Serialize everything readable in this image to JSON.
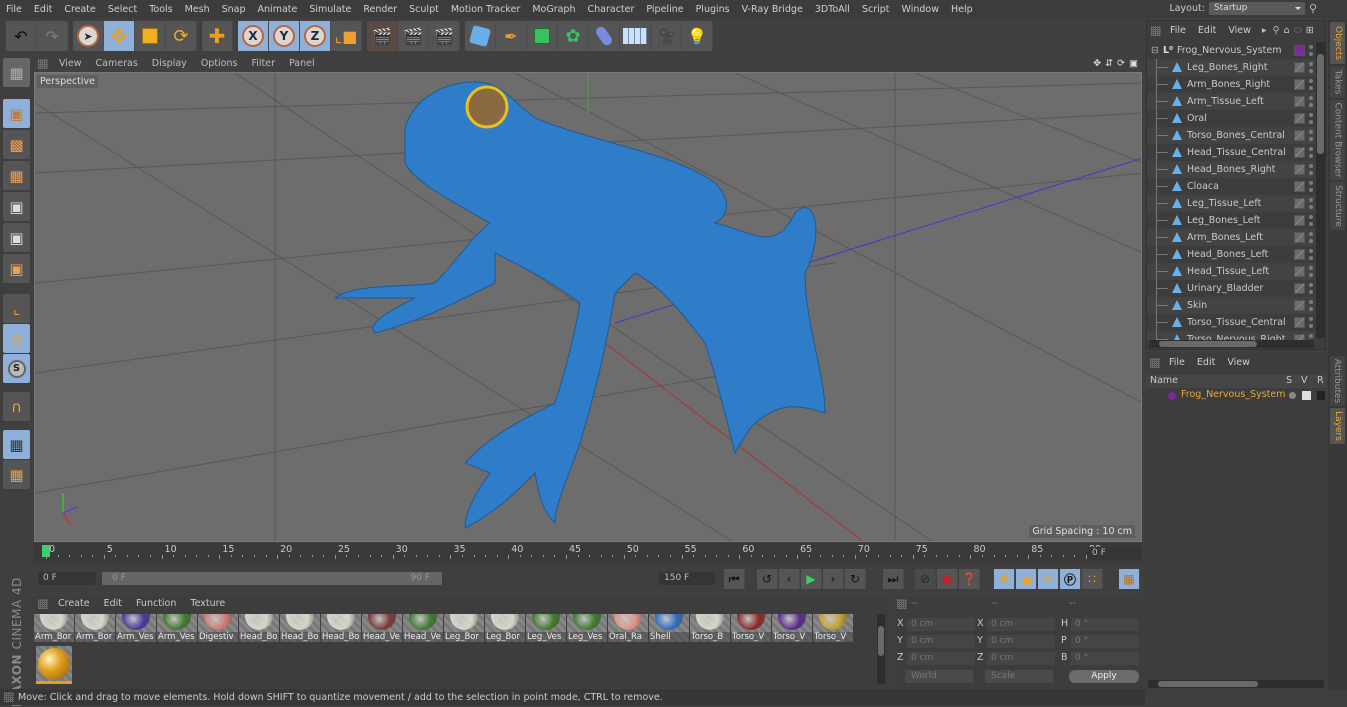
{
  "menubar": {
    "items": [
      "File",
      "Edit",
      "Create",
      "Select",
      "Tools",
      "Mesh",
      "Snap",
      "Animate",
      "Simulate",
      "Render",
      "Sculpt",
      "Motion Tracker",
      "MoGraph",
      "Character",
      "Pipeline",
      "Plugins",
      "V-Ray Bridge",
      "3DToAll",
      "Script",
      "Window",
      "Help"
    ],
    "layout_label": "Layout:",
    "layout_value": "Startup"
  },
  "toolbar": {
    "axis_x": "X",
    "axis_y": "Y",
    "axis_z": "Z"
  },
  "viewport": {
    "menu": [
      "View",
      "Cameras",
      "Display",
      "Options",
      "Filter",
      "Panel"
    ],
    "camera_label": "Perspective",
    "grid_spacing": "Grid Spacing : 10 cm",
    "colors": {
      "model": "#2f7dc8",
      "background": "#6d6d6d"
    }
  },
  "timeline": {
    "ticks": [
      "0",
      "5",
      "10",
      "15",
      "20",
      "25",
      "30",
      "35",
      "40",
      "45",
      "50",
      "55",
      "60",
      "65",
      "70",
      "75",
      "80",
      "85",
      "90"
    ],
    "current_frame": "0 F",
    "start_field": "0 F",
    "range_start": "0 F",
    "range_end": "90 F",
    "end_field": "150 F"
  },
  "materials": {
    "menu": [
      "Create",
      "Edit",
      "Function",
      "Texture"
    ],
    "items": [
      {
        "label": "Arm_Bor",
        "color": "#d8d4c8"
      },
      {
        "label": "Arm_Bor",
        "color": "#d8d4c8"
      },
      {
        "label": "Arm_Ves",
        "color": "#4a3a9a"
      },
      {
        "label": "Arm_Ves",
        "color": "#3f7a30"
      },
      {
        "label": "Digestiv",
        "color": "#d07a78"
      },
      {
        "label": "Head_Bo",
        "color": "#d8d4c8"
      },
      {
        "label": "Head_Bo",
        "color": "#d8d4c8"
      },
      {
        "label": "Head_Bo",
        "color": "#d8d4c8"
      },
      {
        "label": "Head_Ve",
        "color": "#7a3a3a"
      },
      {
        "label": "Head_Ve",
        "color": "#3f7a30"
      },
      {
        "label": "Leg_Bor",
        "color": "#d8d4c8"
      },
      {
        "label": "Leg_Bor",
        "color": "#d8d4c8"
      },
      {
        "label": "Leg_Ves",
        "color": "#3f7a30"
      },
      {
        "label": "Leg_Ves",
        "color": "#3f7a30"
      },
      {
        "label": "Oral_Ra",
        "color": "#e0908a"
      },
      {
        "label": "Shell",
        "color": "#2f6fc0"
      },
      {
        "label": "Torso_B",
        "color": "#d8d4c8"
      },
      {
        "label": "Torso_V",
        "color": "#8a2a2a"
      },
      {
        "label": "Torso_V",
        "color": "#5a2a8a"
      },
      {
        "label": "Torso_V",
        "color": "#c0a030"
      }
    ],
    "selected_color": "#e0a020"
  },
  "coordinates": {
    "headers": [
      "--",
      "--",
      "--"
    ],
    "rows": [
      {
        "l1": "X",
        "v1": "0 cm",
        "l2": "X",
        "v2": "0 cm",
        "l3": "H",
        "v3": "0 °"
      },
      {
        "l1": "Y",
        "v1": "0 cm",
        "l2": "Y",
        "v2": "0 cm",
        "l3": "P",
        "v3": "0 °"
      },
      {
        "l1": "Z",
        "v1": "0 cm",
        "l2": "Z",
        "v2": "0 cm",
        "l3": "B",
        "v3": "0 °"
      }
    ],
    "mode": "World",
    "transform": "Scale",
    "apply": "Apply"
  },
  "objects": {
    "menu": [
      "File",
      "Edit",
      "View"
    ],
    "root": "Frog_Nervous_System",
    "root_color": "#7a2a9a",
    "children": [
      "Leg_Bones_Right",
      "Arm_Bones_Right",
      "Arm_Tissue_Left",
      "Oral",
      "Torso_Bones_Central",
      "Head_Tissue_Central",
      "Head_Bones_Right",
      "Cloaca",
      "Leg_Tissue_Left",
      "Leg_Bones_Left",
      "Arm_Bones_Left",
      "Head_Bones_Left",
      "Head_Tissue_Left",
      "Urinary_Bladder",
      "Skin",
      "Torso_Tissue_Central",
      "Torso_Nervous_Right"
    ]
  },
  "layers": {
    "menu": [
      "File",
      "Edit",
      "View"
    ],
    "col_name": "Name",
    "col_s": "S",
    "col_v": "V",
    "col_r": "R",
    "items": [
      {
        "name": "Frog_Nervous_System",
        "color": "#e8a83c"
      }
    ]
  },
  "sidetabs": [
    "Objects",
    "Takes",
    "Content Browser",
    "Structure",
    "Attributes",
    "Layers"
  ],
  "brand": {
    "line1": "MAXON",
    "line2": "CINEMA 4D"
  },
  "status": "Move: Click and drag to move elements. Hold down SHIFT to quantize movement / add to the selection in point mode, CTRL to remove."
}
